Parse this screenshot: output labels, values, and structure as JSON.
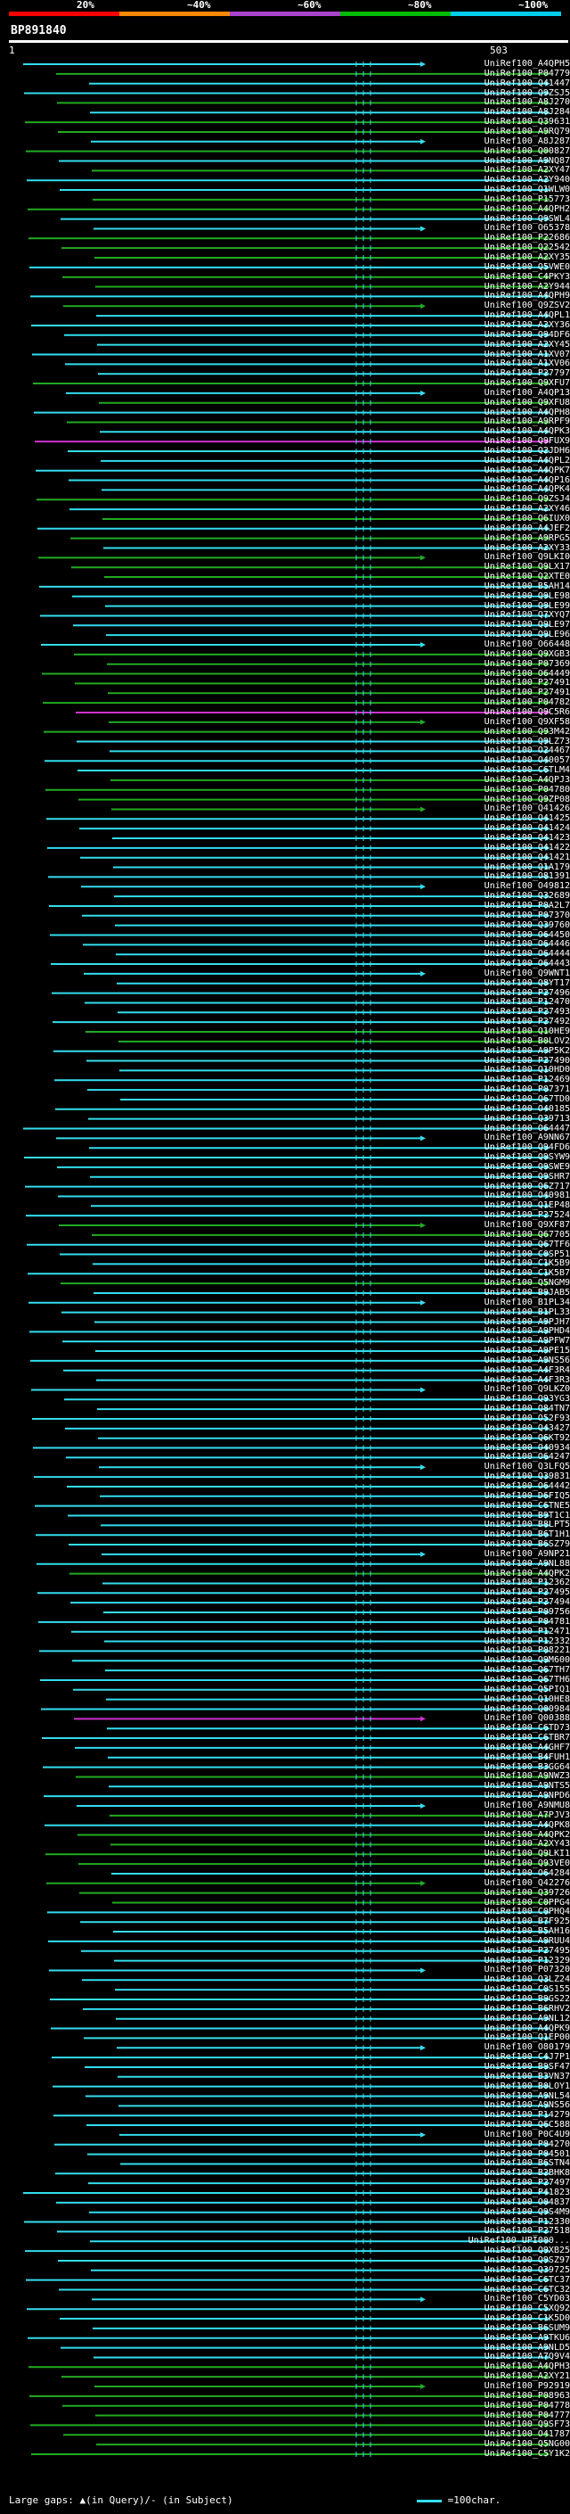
{
  "header": {
    "query_id": "BP891840",
    "scale_ticks": [
      "20%",
      "~40%",
      "~60%",
      "~80%",
      "~100%"
    ],
    "tick_colors": [
      "#ff0000",
      "#ff8800",
      "#aa44cc",
      "#00bb00",
      "#00ccee"
    ],
    "scale_start": "1",
    "scale_end": "503"
  },
  "legend": {
    "gaps_text": "Large gaps: ▲(in Query)/- (in Subject)",
    "scale_text": "=100char."
  },
  "colors": {
    "background": "#000000",
    "hit_cyan": "#33ddee",
    "hit_green": "#22aa22",
    "hit_magenta": "#cc33cc",
    "marker": "#33ddee",
    "scale_bar": "#ffffff",
    "label_text": "#ffffff"
  },
  "chart_data": {
    "type": "alignment-hits",
    "query_length": 503,
    "hits": [
      {
        "label": "UniRef100_A4QPH5",
        "c": "cyan"
      },
      {
        "label": "UniRef100_P04779",
        "c": "green"
      },
      {
        "label": "UniRef100_Q41447",
        "c": "cyan"
      },
      {
        "label": "UniRef100_Q9ZSJ5",
        "c": "cyan"
      },
      {
        "label": "UniRef100_A8J270",
        "c": "green"
      },
      {
        "label": "UniRef100_A8J284",
        "c": "cyan"
      },
      {
        "label": "UniRef100_Q39631",
        "c": "green"
      },
      {
        "label": "UniRef100_A9RQ79",
        "c": "green"
      },
      {
        "label": "UniRef100_A8J287",
        "c": "cyan"
      },
      {
        "label": "UniRef100_Q00827",
        "c": "green"
      },
      {
        "label": "UniRef100_A9NQ87",
        "c": "cyan"
      },
      {
        "label": "UniRef100_A2XY47",
        "c": "green"
      },
      {
        "label": "UniRef100_A2Y940",
        "c": "cyan"
      },
      {
        "label": "UniRef100_Q1WLW0",
        "c": "cyan"
      },
      {
        "label": "UniRef100_P15773",
        "c": "green"
      },
      {
        "label": "UniRef100_A4QPH2",
        "c": "green"
      },
      {
        "label": "UniRef100_Q9SWL4",
        "c": "cyan"
      },
      {
        "label": "UniRef100_O65378",
        "c": "cyan"
      },
      {
        "label": "UniRef100_P22686",
        "c": "green"
      },
      {
        "label": "UniRef100_Q22542",
        "c": "green"
      },
      {
        "label": "UniRef100_A2XY35",
        "c": "green"
      },
      {
        "label": "UniRef100_Q5VWE0",
        "c": "cyan"
      },
      {
        "label": "UniRef100_C4PKY3",
        "c": "green"
      },
      {
        "label": "UniRef100_A2Y944",
        "c": "green"
      },
      {
        "label": "UniRef100_A4QPH9",
        "c": "cyan"
      },
      {
        "label": "UniRef100_Q9ZSV2",
        "c": "green"
      },
      {
        "label": "UniRef100_A4QPL1",
        "c": "cyan"
      },
      {
        "label": "UniRef100_A2XY36",
        "c": "cyan"
      },
      {
        "label": "UniRef100_Q94DF6",
        "c": "cyan"
      },
      {
        "label": "UniRef100_A2XY45",
        "c": "cyan"
      },
      {
        "label": "UniRef100_A1XV07",
        "c": "cyan"
      },
      {
        "label": "UniRef100_A1XV06",
        "c": "cyan"
      },
      {
        "label": "UniRef100_P27797",
        "c": "cyan"
      },
      {
        "label": "UniRef100_Q9XFU7",
        "c": "green"
      },
      {
        "label": "UniRef100_A4QP13",
        "c": "cyan"
      },
      {
        "label": "UniRef100_Q9XFU8",
        "c": "green"
      },
      {
        "label": "UniRef100_A4QPH8",
        "c": "cyan"
      },
      {
        "label": "UniRef100_A9RPF9",
        "c": "green"
      },
      {
        "label": "UniRef100_A4QPK3",
        "c": "cyan"
      },
      {
        "label": "UniRef100_Q9FUX9",
        "c": "magenta"
      },
      {
        "label": "UniRef100_Q2JDH6",
        "c": "cyan"
      },
      {
        "label": "UniRef100_A4QPL2",
        "c": "cyan"
      },
      {
        "label": "UniRef100_A4QPK7",
        "c": "cyan"
      },
      {
        "label": "UniRef100_A4QP16",
        "c": "cyan"
      },
      {
        "label": "UniRef100_A4QPK4",
        "c": "cyan"
      },
      {
        "label": "UniRef100_Q9ZSJ4",
        "c": "green"
      },
      {
        "label": "UniRef100_A2XY46",
        "c": "cyan"
      },
      {
        "label": "UniRef100_Q6IUX0",
        "c": "green"
      },
      {
        "label": "UniRef100_A4JEF2",
        "c": "cyan"
      },
      {
        "label": "UniRef100_A9RPG5",
        "c": "green"
      },
      {
        "label": "UniRef100_A2XY33",
        "c": "cyan"
      },
      {
        "label": "UniRef100_Q9LKI0",
        "c": "green"
      },
      {
        "label": "UniRef100_Q9LX17",
        "c": "green"
      },
      {
        "label": "UniRef100_Q2XTE0",
        "c": "green"
      },
      {
        "label": "UniRef100_B5AH14",
        "c": "cyan"
      },
      {
        "label": "UniRef100_Q9LE98",
        "c": "cyan"
      },
      {
        "label": "UniRef100_Q9LE99",
        "c": "cyan"
      },
      {
        "label": "UniRef100_Q7XYQ7",
        "c": "cyan"
      },
      {
        "label": "UniRef100_Q9LE97",
        "c": "cyan"
      },
      {
        "label": "UniRef100_Q9LE96",
        "c": "cyan"
      },
      {
        "label": "UniRef100_O66448",
        "c": "cyan"
      },
      {
        "label": "UniRef100_Q9XGB3",
        "c": "green"
      },
      {
        "label": "UniRef100_P07369",
        "c": "green"
      },
      {
        "label": "UniRef100_O64449",
        "c": "green"
      },
      {
        "label": "UniRef100_P27491",
        "c": "green"
      },
      {
        "label": "UniRef100_P27491",
        "c": "green"
      },
      {
        "label": "UniRef100_P04782",
        "c": "green"
      },
      {
        "label": "UniRef100_Q9C5R6",
        "c": "magenta"
      },
      {
        "label": "UniRef100_Q9XF58",
        "c": "green"
      },
      {
        "label": "UniRef100_Q93M42",
        "c": "green"
      },
      {
        "label": "UniRef100_Q9LZ73",
        "c": "cyan"
      },
      {
        "label": "UniRef100_O24467",
        "c": "cyan"
      },
      {
        "label": "UniRef100_O40057",
        "c": "cyan"
      },
      {
        "label": "UniRef100_C6TLM4",
        "c": "cyan"
      },
      {
        "label": "UniRef100_A4QPJ3",
        "c": "green"
      },
      {
        "label": "UniRef100_P04780",
        "c": "green"
      },
      {
        "label": "UniRef100_Q9ZP08",
        "c": "green"
      },
      {
        "label": "UniRef100_Q41426",
        "c": "green"
      },
      {
        "label": "UniRef100_Q41425",
        "c": "cyan"
      },
      {
        "label": "UniRef100_Q41424",
        "c": "cyan"
      },
      {
        "label": "UniRef100_Q41423",
        "c": "cyan"
      },
      {
        "label": "UniRef100_Q41422",
        "c": "cyan"
      },
      {
        "label": "UniRef100_Q41421",
        "c": "cyan"
      },
      {
        "label": "UniRef100_Q1A179",
        "c": "cyan"
      },
      {
        "label": "UniRef100_O81391",
        "c": "cyan"
      },
      {
        "label": "UniRef100_O49812",
        "c": "cyan"
      },
      {
        "label": "UniRef100_Q32689",
        "c": "cyan"
      },
      {
        "label": "UniRef100_P0A2L7",
        "c": "cyan"
      },
      {
        "label": "UniRef100_P07370",
        "c": "cyan"
      },
      {
        "label": "UniRef100_Q39760",
        "c": "cyan"
      },
      {
        "label": "UniRef100_O64450",
        "c": "cyan"
      },
      {
        "label": "UniRef100_O64446",
        "c": "cyan"
      },
      {
        "label": "UniRef100_O64444",
        "c": "cyan"
      },
      {
        "label": "UniRef100_O64443",
        "c": "cyan"
      },
      {
        "label": "UniRef100_Q9WNT1",
        "c": "cyan"
      },
      {
        "label": "UniRef100_Q8YT17",
        "c": "cyan"
      },
      {
        "label": "UniRef100_P27496",
        "c": "cyan"
      },
      {
        "label": "UniRef100_P12470",
        "c": "cyan"
      },
      {
        "label": "UniRef100_P27493",
        "c": "cyan"
      },
      {
        "label": "UniRef100_P27492",
        "c": "cyan"
      },
      {
        "label": "UniRef100_Q10HE9",
        "c": "green"
      },
      {
        "label": "UniRef100_B0LOV2",
        "c": "green"
      },
      {
        "label": "UniRef100_A9P5K2",
        "c": "cyan"
      },
      {
        "label": "UniRef100_P27490",
        "c": "cyan"
      },
      {
        "label": "UniRef100_Q10HD0",
        "c": "cyan"
      },
      {
        "label": "UniRef100_P12469",
        "c": "cyan"
      },
      {
        "label": "UniRef100_P07371",
        "c": "cyan"
      },
      {
        "label": "UniRef100_Q67TD0",
        "c": "cyan"
      },
      {
        "label": "UniRef100_O40185",
        "c": "cyan"
      },
      {
        "label": "UniRef100_Q39713",
        "c": "cyan"
      },
      {
        "label": "UniRef100_O64447",
        "c": "cyan"
      },
      {
        "label": "UniRef100_A9NN67",
        "c": "cyan"
      },
      {
        "label": "UniRef100_Q94FD6",
        "c": "cyan"
      },
      {
        "label": "UniRef100_Q9SYW9",
        "c": "cyan"
      },
      {
        "label": "UniRef100_Q9SWE9",
        "c": "cyan"
      },
      {
        "label": "UniRef100_Q9SHR7",
        "c": "cyan"
      },
      {
        "label": "UniRef100_Q6Z717",
        "c": "cyan"
      },
      {
        "label": "UniRef100_O40981",
        "c": "cyan"
      },
      {
        "label": "UniRef100_Q1EP48",
        "c": "cyan"
      },
      {
        "label": "UniRef100_P27524",
        "c": "cyan"
      },
      {
        "label": "UniRef100_Q9XF87",
        "c": "green"
      },
      {
        "label": "UniRef100_Q67705",
        "c": "green"
      },
      {
        "label": "UniRef100_Q67TF6",
        "c": "cyan"
      },
      {
        "label": "UniRef100_C0SP51",
        "c": "cyan"
      },
      {
        "label": "UniRef100_C1K5B9",
        "c": "cyan"
      },
      {
        "label": "UniRef100_C1K5B7",
        "c": "cyan"
      },
      {
        "label": "UniRef100_Q5NGM9",
        "c": "green"
      },
      {
        "label": "UniRef100_B9JAB5",
        "c": "cyan"
      },
      {
        "label": "UniRef100_B1PL34",
        "c": "cyan"
      },
      {
        "label": "UniRef100_B1PL33",
        "c": "cyan"
      },
      {
        "label": "UniRef100_A9PJH7",
        "c": "cyan"
      },
      {
        "label": "UniRef100_A9PHD4",
        "c": "cyan"
      },
      {
        "label": "UniRef100_A9PFW7",
        "c": "cyan"
      },
      {
        "label": "UniRef100_A9PE15",
        "c": "cyan"
      },
      {
        "label": "UniRef100_A9NS56",
        "c": "cyan"
      },
      {
        "label": "UniRef100_A4F3R4",
        "c": "cyan"
      },
      {
        "label": "UniRef100_A4F3R3",
        "c": "cyan"
      },
      {
        "label": "UniRef100_Q9LKZ0",
        "c": "cyan"
      },
      {
        "label": "UniRef100_Q93YG3",
        "c": "cyan"
      },
      {
        "label": "UniRef100_Q84TN7",
        "c": "cyan"
      },
      {
        "label": "UniRef100_O52F93",
        "c": "cyan"
      },
      {
        "label": "UniRef100_Q43427",
        "c": "cyan"
      },
      {
        "label": "UniRef100_Q6KT92",
        "c": "cyan"
      },
      {
        "label": "UniRef100_O40934",
        "c": "cyan"
      },
      {
        "label": "UniRef100_O64247",
        "c": "cyan"
      },
      {
        "label": "UniRef100_Q3LFQ5",
        "c": "cyan"
      },
      {
        "label": "UniRef100_Q39831",
        "c": "cyan"
      },
      {
        "label": "UniRef100_O64442",
        "c": "cyan"
      },
      {
        "label": "UniRef100_D6FIQ5",
        "c": "cyan"
      },
      {
        "label": "UniRef100_C6TNE5",
        "c": "cyan"
      },
      {
        "label": "UniRef100_B9T1C1",
        "c": "cyan"
      },
      {
        "label": "UniRef100_B8LPT5",
        "c": "cyan"
      },
      {
        "label": "UniRef100_B6T1H1",
        "c": "cyan"
      },
      {
        "label": "UniRef100_B6SZ79",
        "c": "cyan"
      },
      {
        "label": "UniRef100_A9NP21",
        "c": "cyan"
      },
      {
        "label": "UniRef100_A9NL88",
        "c": "cyan"
      },
      {
        "label": "UniRef100_A4QPK2",
        "c": "green"
      },
      {
        "label": "UniRef100_P12362",
        "c": "cyan"
      },
      {
        "label": "UniRef100_P27495",
        "c": "cyan"
      },
      {
        "label": "UniRef100_P27494",
        "c": "cyan"
      },
      {
        "label": "UniRef100_P09756",
        "c": "cyan"
      },
      {
        "label": "UniRef100_P04781",
        "c": "cyan"
      },
      {
        "label": "UniRef100_P12471",
        "c": "cyan"
      },
      {
        "label": "UniRef100_P12332",
        "c": "cyan"
      },
      {
        "label": "UniRef100_P08221",
        "c": "cyan"
      },
      {
        "label": "UniRef100_Q9M600",
        "c": "cyan"
      },
      {
        "label": "UniRef100_Q67TH7",
        "c": "cyan"
      },
      {
        "label": "UniRef100_Q67TH6",
        "c": "cyan"
      },
      {
        "label": "UniRef100_Q5PIQ1",
        "c": "cyan"
      },
      {
        "label": "UniRef100_Q10HE8",
        "c": "cyan"
      },
      {
        "label": "UniRef100_Q00984",
        "c": "cyan"
      },
      {
        "label": "UniRef100_Q00388",
        "c": "magenta"
      },
      {
        "label": "UniRef100_C6TD73",
        "c": "cyan"
      },
      {
        "label": "UniRef100_C6TBR7",
        "c": "cyan"
      },
      {
        "label": "UniRef100_A4GHF7",
        "c": "cyan"
      },
      {
        "label": "UniRef100_B4FUH1",
        "c": "cyan"
      },
      {
        "label": "UniRef100_B3GG64",
        "c": "cyan"
      },
      {
        "label": "UniRef100_A9NWZ3",
        "c": "green"
      },
      {
        "label": "UniRef100_A9NTS5",
        "c": "cyan"
      },
      {
        "label": "UniRef100_A9NPD6",
        "c": "cyan"
      },
      {
        "label": "UniRef100_A9NMU8",
        "c": "cyan"
      },
      {
        "label": "UniRef100_A7PJV3",
        "c": "green"
      },
      {
        "label": "UniRef100_A4QPK8",
        "c": "cyan"
      },
      {
        "label": "UniRef100_A4QPK2",
        "c": "green"
      },
      {
        "label": "UniRef100_A2XY43",
        "c": "green"
      },
      {
        "label": "UniRef100_Q9LKI1",
        "c": "green"
      },
      {
        "label": "UniRef100_Q93VE0",
        "c": "green"
      },
      {
        "label": "UniRef100_O64284",
        "c": "cyan"
      },
      {
        "label": "UniRef100_Q42276",
        "c": "green"
      },
      {
        "label": "UniRef100_Q39726",
        "c": "green"
      },
      {
        "label": "UniRef100_C0PPG4",
        "c": "green"
      },
      {
        "label": "UniRef100_C0PHQ4",
        "c": "cyan"
      },
      {
        "label": "UniRef100_B7F925",
        "c": "cyan"
      },
      {
        "label": "UniRef100_B5AH16",
        "c": "cyan"
      },
      {
        "label": "UniRef100_A9RUU4",
        "c": "cyan"
      },
      {
        "label": "UniRef100_P27495",
        "c": "cyan"
      },
      {
        "label": "UniRef100_P12329",
        "c": "cyan"
      },
      {
        "label": "UniRef100_P07320",
        "c": "cyan"
      },
      {
        "label": "UniRef100_Q3LZ24",
        "c": "cyan"
      },
      {
        "label": "UniRef100_C0S155",
        "c": "cyan"
      },
      {
        "label": "UniRef100_B9GS22",
        "c": "cyan"
      },
      {
        "label": "UniRef100_B6RHV2",
        "c": "cyan"
      },
      {
        "label": "UniRef100_A9NL12",
        "c": "cyan"
      },
      {
        "label": "UniRef100_A4QPK9",
        "c": "cyan"
      },
      {
        "label": "UniRef100_Q1EP00",
        "c": "cyan"
      },
      {
        "label": "UniRef100_O80179",
        "c": "cyan"
      },
      {
        "label": "UniRef100_C4J7P1",
        "c": "cyan"
      },
      {
        "label": "UniRef100_B9SF47",
        "c": "cyan"
      },
      {
        "label": "UniRef100_B3VN37",
        "c": "cyan"
      },
      {
        "label": "UniRef100_B0LOY1",
        "c": "cyan"
      },
      {
        "label": "UniRef100_A9NL54",
        "c": "cyan"
      },
      {
        "label": "UniRef100_A9NS56",
        "c": "cyan"
      },
      {
        "label": "UniRef100_P14279",
        "c": "cyan"
      },
      {
        "label": "UniRef100_Q6C588",
        "c": "cyan"
      },
      {
        "label": "UniRef100_P0C4U9",
        "c": "cyan"
      },
      {
        "label": "UniRef100_P04270",
        "c": "cyan"
      },
      {
        "label": "UniRef100_P04501",
        "c": "cyan"
      },
      {
        "label": "UniRef100_B6STN4",
        "c": "cyan"
      },
      {
        "label": "UniRef100_B2BHK8",
        "c": "cyan"
      },
      {
        "label": "UniRef100_P27497",
        "c": "cyan"
      },
      {
        "label": "UniRef100_P41823",
        "c": "cyan"
      },
      {
        "label": "UniRef100_O04837",
        "c": "cyan"
      },
      {
        "label": "UniRef100_Q9S4M9",
        "c": "cyan"
      },
      {
        "label": "UniRef100_P12330",
        "c": "cyan"
      },
      {
        "label": "UniRef100_P27518",
        "c": "cyan"
      },
      {
        "label": "UniRef100_UPI000...",
        "c": "cyan"
      },
      {
        "label": "UniRef100_Q9XB25",
        "c": "cyan"
      },
      {
        "label": "UniRef100_Q9SZ97",
        "c": "cyan"
      },
      {
        "label": "UniRef100_Q39725",
        "c": "cyan"
      },
      {
        "label": "UniRef100_C6TC37",
        "c": "cyan"
      },
      {
        "label": "UniRef100_C6TC32",
        "c": "cyan"
      },
      {
        "label": "UniRef100_C5YD03",
        "c": "cyan"
      },
      {
        "label": "UniRef100_C5XQ92",
        "c": "cyan"
      },
      {
        "label": "UniRef100_C1K5D0",
        "c": "cyan"
      },
      {
        "label": "UniRef100_B6SUM9",
        "c": "cyan"
      },
      {
        "label": "UniRef100_A9TKU6",
        "c": "cyan"
      },
      {
        "label": "UniRef100_A9NLD5",
        "c": "cyan"
      },
      {
        "label": "UniRef100_A7Q9V4",
        "c": "cyan"
      },
      {
        "label": "UniRef100_A4QPH3",
        "c": "green"
      },
      {
        "label": "UniRef100_A2XY21",
        "c": "green"
      },
      {
        "label": "UniRef100_P92919",
        "c": "green"
      },
      {
        "label": "UniRef100_P08963",
        "c": "green"
      },
      {
        "label": "UniRef100_P04778",
        "c": "green"
      },
      {
        "label": "UniRef100_P04777",
        "c": "green"
      },
      {
        "label": "UniRef100_Q9SF73",
        "c": "green"
      },
      {
        "label": "UniRef100_O41787",
        "c": "green"
      },
      {
        "label": "UniRef100_Q5NG00",
        "c": "green"
      },
      {
        "label": "UniRef100_C5Y1K2",
        "c": "green"
      }
    ]
  }
}
